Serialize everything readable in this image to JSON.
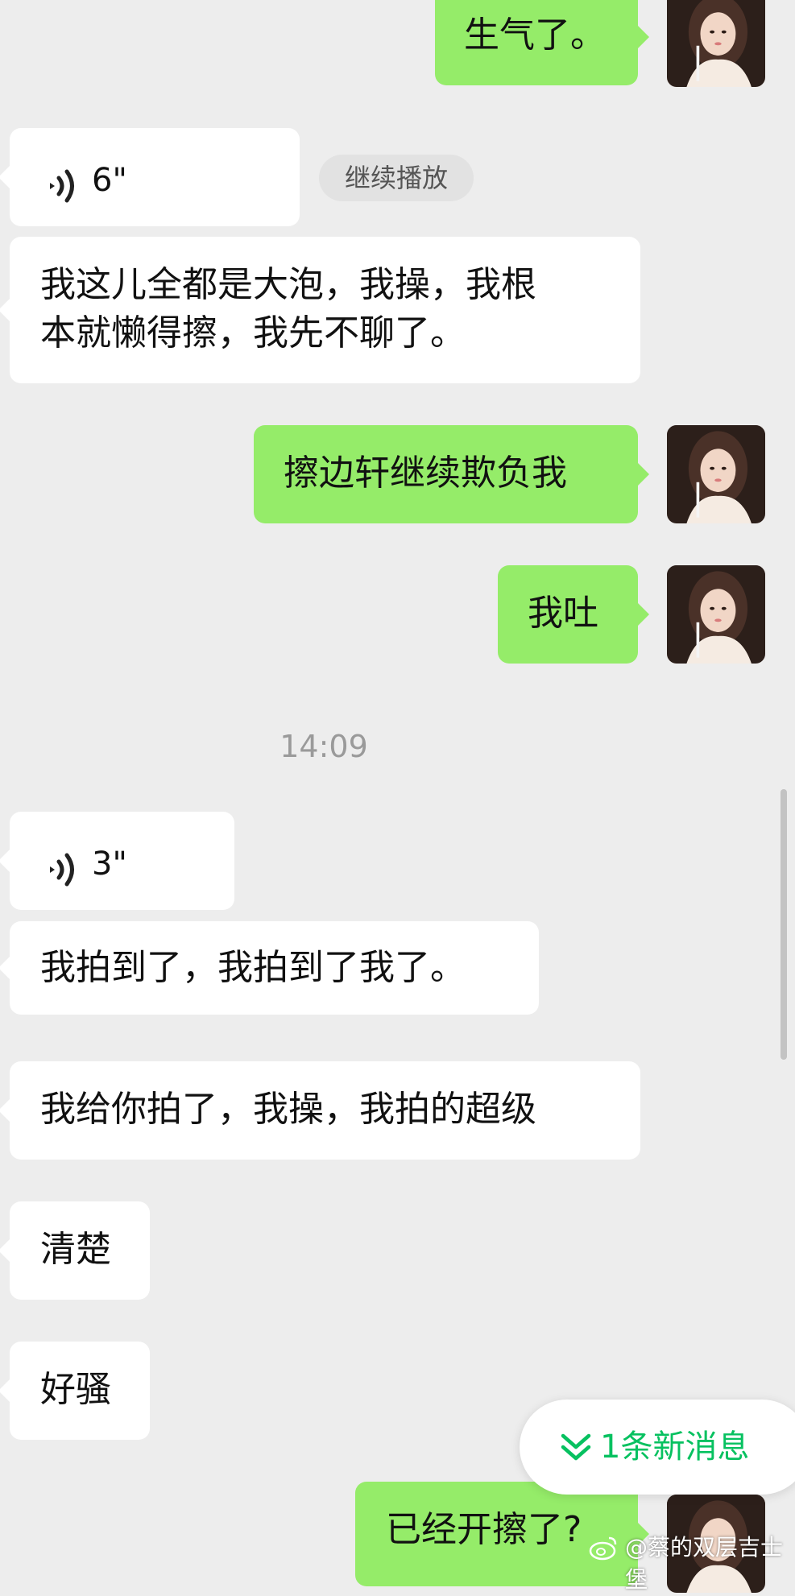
{
  "messages": [
    {
      "id": "m1",
      "side": "sent",
      "text": "生气了。"
    },
    {
      "id": "m2",
      "side": "recv",
      "type": "voice",
      "duration": "6\""
    },
    {
      "id": "m3",
      "side": "recv",
      "text_lines": [
        "我这儿全都是大泡，我操，我根",
        "本就懒得擦，我先不聊了。"
      ]
    },
    {
      "id": "m4",
      "side": "sent",
      "text": "擦边轩继续欺负我"
    },
    {
      "id": "m5",
      "side": "sent",
      "text": "我吐"
    },
    {
      "id": "m6",
      "side": "recv",
      "type": "voice",
      "duration": "3\""
    },
    {
      "id": "m7",
      "side": "recv",
      "text": "我拍到了，我拍到了我了。"
    },
    {
      "id": "m8",
      "side": "recv",
      "text": "我给你拍了，我操，我拍的超级"
    },
    {
      "id": "m9",
      "side": "recv",
      "text": "清楚"
    },
    {
      "id": "m10",
      "side": "recv",
      "text": "好骚"
    },
    {
      "id": "m11",
      "side": "sent",
      "text": "已经开擦了?"
    }
  ],
  "continue_play_label": "继续播放",
  "timestamp": "14:09",
  "new_message_button": {
    "label": "1条新消息"
  },
  "watermark": "@蔡的双层吉士堡",
  "colors": {
    "background": "#ededed",
    "sent_bubble": "#95ec69",
    "recv_bubble": "#ffffff",
    "accent": "#07c160"
  },
  "icons": [
    "voice-wave-icon",
    "double-chevron-down-icon",
    "weibo-icon",
    "avatar"
  ]
}
